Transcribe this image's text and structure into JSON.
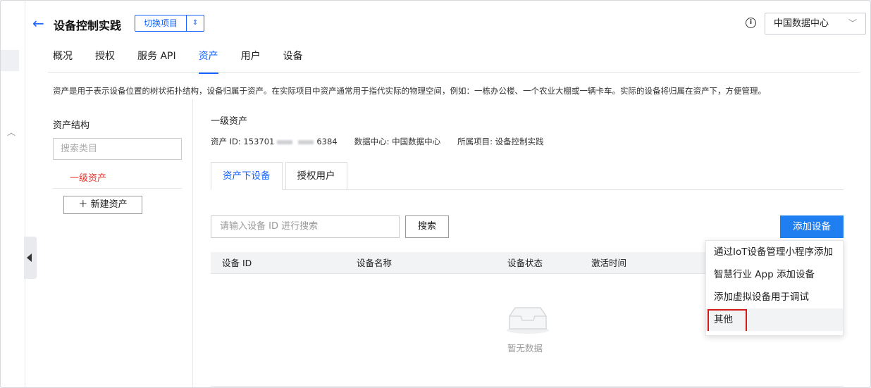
{
  "header": {
    "title": "设备控制实践",
    "switch_label": "切换项目",
    "info_icon": "i",
    "region": "中国数据中心"
  },
  "tabs": [
    "概况",
    "授权",
    "服务 API",
    "资产",
    "用户",
    "设备"
  ],
  "active_tab": "资产",
  "description": "资产是用于表示设备位置的树状拓扑结构，设备归属于资产。在实际项目中资产通常用于指代实际的物理空间，例如：一栋办公楼、一个农业大棚或一辆卡车。实际的设备将归属在资产下，方便管理。",
  "structure": {
    "heading": "资产结构",
    "search_placeholder": "搜索类目",
    "item": "一级资产",
    "new_button": "新建资产"
  },
  "asset": {
    "heading": "一级资产",
    "id_prefix": "资产 ID: 153701",
    "id_suffix": "6384",
    "datacenter": "数据中心: 中国数据中心",
    "project": "所属项目: 设备控制实践"
  },
  "subtabs": [
    "资产下设备",
    "授权用户"
  ],
  "device_search_placeholder": "请输入设备 ID 进行搜索",
  "search_button": "搜索",
  "add_button": "添加设备",
  "table": {
    "columns": [
      "设备 ID",
      "设备名称",
      "设备状态",
      "激活时间"
    ],
    "empty": "暂无数据"
  },
  "dropdown": [
    "通过IoT设备管理小程序添加",
    "智慧行业 App 添加设备",
    "添加虚拟设备用于调试",
    "其他"
  ],
  "colors": {
    "accent": "#1664ff",
    "danger": "#e5352c",
    "highlight_box": "#d51a1a"
  }
}
